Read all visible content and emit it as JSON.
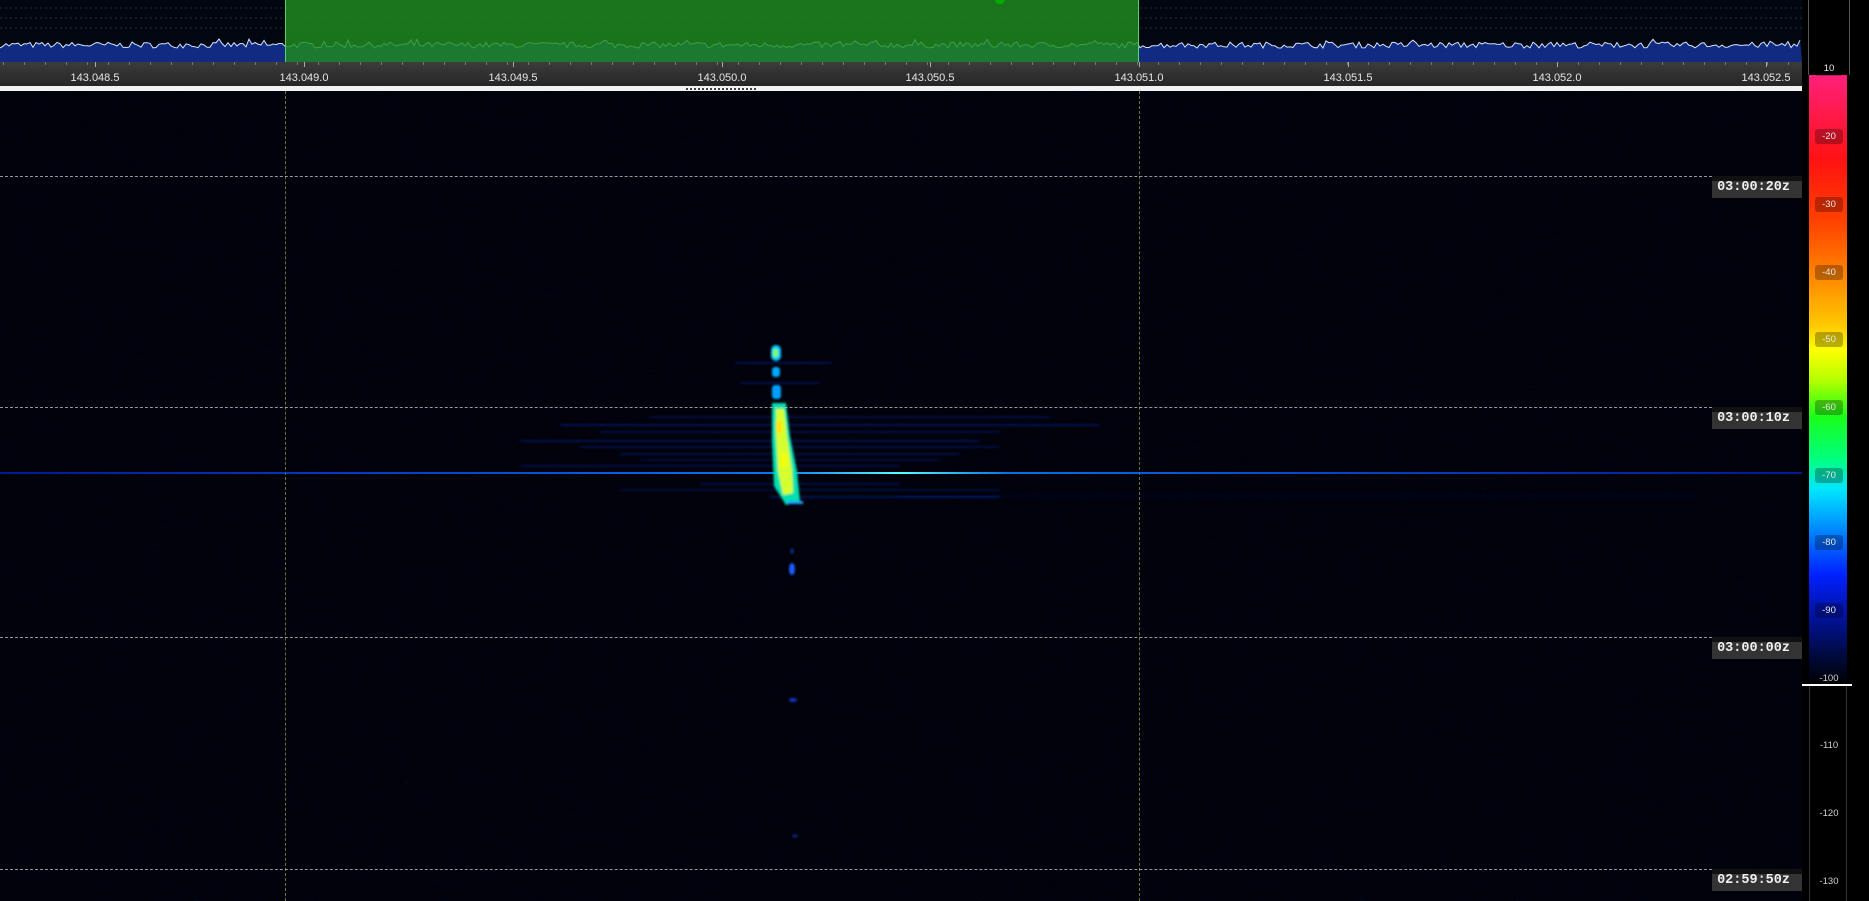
{
  "spectrum": {
    "frequency_labels": [
      "143.048.5",
      "143.049.0",
      "143.049.5",
      "143.050.0",
      "143.050.5",
      "143.051.0",
      "143.051.5",
      "143.052.0",
      "143.052.5"
    ]
  },
  "waterfall": {
    "time_labels": [
      "03:00:20z",
      "03:00:10z",
      "03:00:00z",
      "02:59:50z"
    ]
  },
  "colorbar": {
    "labels": [
      "10",
      "-20",
      "-30",
      "-40",
      "-50",
      "-60",
      "-70",
      "-80",
      "-90",
      "-100",
      "-110",
      "-120",
      "-130"
    ]
  },
  "colors": {
    "filter_passband": "#1e8c1e",
    "spectrum_trace": "#cfe4ff",
    "spectrum_fill": "#13308f",
    "grid_line": "#c8d250",
    "background": "#000000"
  }
}
